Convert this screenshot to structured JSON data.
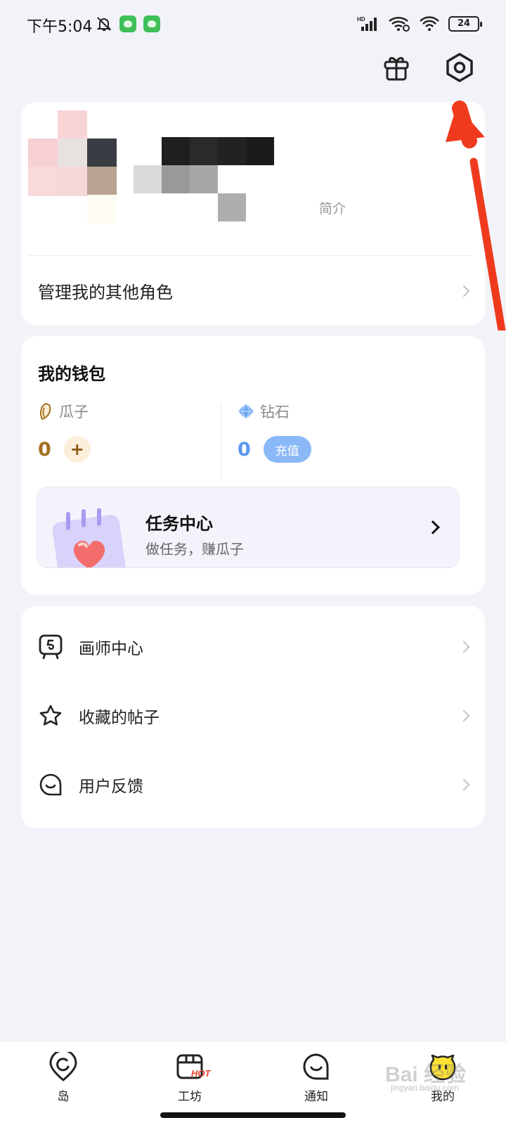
{
  "status_bar": {
    "time": "下午5:04",
    "battery": "24",
    "network_label": "HD"
  },
  "top_actions": {
    "gift_icon": "gift-icon",
    "settings_icon": "settings-icon"
  },
  "profile": {
    "bio_label": "简介",
    "manage_roles_label": "管理我的其他角色"
  },
  "wallet": {
    "title": "我的钱包",
    "seeds": {
      "label": "瓜子",
      "value": "0",
      "add_label": "+"
    },
    "diamonds": {
      "label": "钻石",
      "value": "0",
      "recharge_label": "充值"
    },
    "task_center": {
      "title": "任务中心",
      "subtitle": "做任务，赚瓜子"
    }
  },
  "menu": [
    {
      "label": "画师中心",
      "icon": "artist-icon"
    },
    {
      "label": "收藏的帖子",
      "icon": "star-icon"
    },
    {
      "label": "用户反馈",
      "icon": "feedback-icon"
    }
  ],
  "bottom_nav": [
    {
      "label": "岛",
      "icon": "island-icon"
    },
    {
      "label": "工坊",
      "icon": "workshop-icon",
      "badge": "HOT"
    },
    {
      "label": "通知",
      "icon": "notification-icon"
    },
    {
      "label": "我的",
      "icon": "profile-icon",
      "active": true
    }
  ],
  "watermark": {
    "text": "Bai 经验",
    "sub": "jingyan.baidu.com"
  },
  "colors": {
    "accent_red": "#e8432f",
    "seed_gold": "#a36f1e",
    "diamond_blue": "#5a98ef",
    "background": "#f2f3f8"
  }
}
